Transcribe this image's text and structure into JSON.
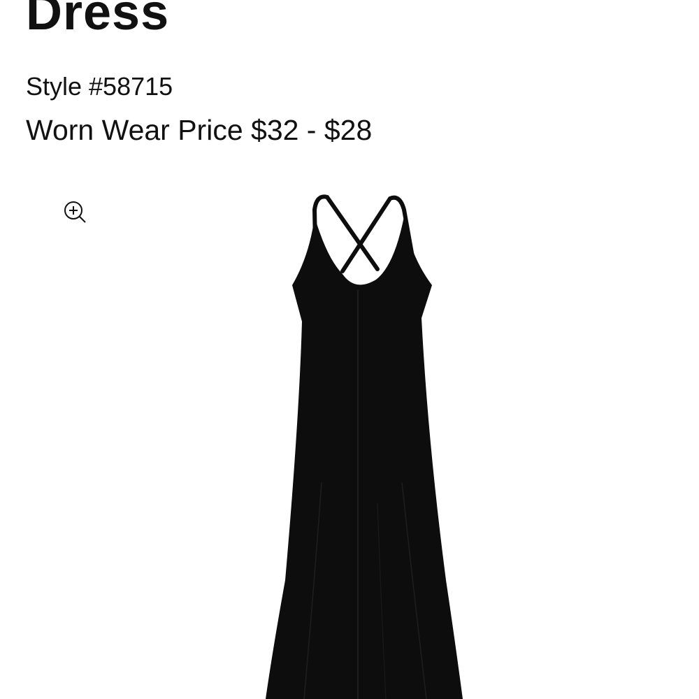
{
  "product": {
    "title": "Dress",
    "style_number": "Style #58715",
    "price": "Worn Wear Price $32 - $28"
  },
  "gallery": {
    "zoom_icon": "zoom-in-icon",
    "image_subject": "black-maxi-dress",
    "image_color": "#0d0d0d"
  }
}
